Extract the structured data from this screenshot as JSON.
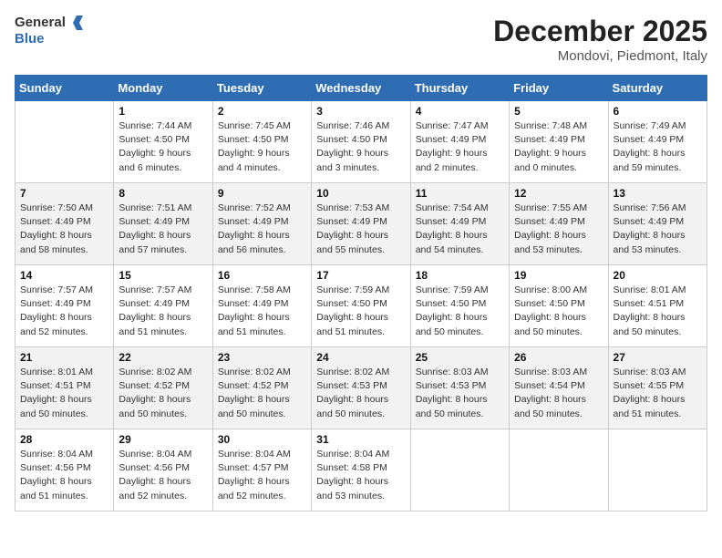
{
  "header": {
    "logo_line1": "General",
    "logo_line2": "Blue",
    "month": "December 2025",
    "location": "Mondovi, Piedmont, Italy"
  },
  "weekdays": [
    "Sunday",
    "Monday",
    "Tuesday",
    "Wednesday",
    "Thursday",
    "Friday",
    "Saturday"
  ],
  "weeks": [
    [
      {
        "day": "",
        "sunrise": "",
        "sunset": "",
        "daylight": ""
      },
      {
        "day": "1",
        "sunrise": "Sunrise: 7:44 AM",
        "sunset": "Sunset: 4:50 PM",
        "daylight": "Daylight: 9 hours and 6 minutes."
      },
      {
        "day": "2",
        "sunrise": "Sunrise: 7:45 AM",
        "sunset": "Sunset: 4:50 PM",
        "daylight": "Daylight: 9 hours and 4 minutes."
      },
      {
        "day": "3",
        "sunrise": "Sunrise: 7:46 AM",
        "sunset": "Sunset: 4:50 PM",
        "daylight": "Daylight: 9 hours and 3 minutes."
      },
      {
        "day": "4",
        "sunrise": "Sunrise: 7:47 AM",
        "sunset": "Sunset: 4:49 PM",
        "daylight": "Daylight: 9 hours and 2 minutes."
      },
      {
        "day": "5",
        "sunrise": "Sunrise: 7:48 AM",
        "sunset": "Sunset: 4:49 PM",
        "daylight": "Daylight: 9 hours and 0 minutes."
      },
      {
        "day": "6",
        "sunrise": "Sunrise: 7:49 AM",
        "sunset": "Sunset: 4:49 PM",
        "daylight": "Daylight: 8 hours and 59 minutes."
      }
    ],
    [
      {
        "day": "7",
        "sunrise": "Sunrise: 7:50 AM",
        "sunset": "Sunset: 4:49 PM",
        "daylight": "Daylight: 8 hours and 58 minutes."
      },
      {
        "day": "8",
        "sunrise": "Sunrise: 7:51 AM",
        "sunset": "Sunset: 4:49 PM",
        "daylight": "Daylight: 8 hours and 57 minutes."
      },
      {
        "day": "9",
        "sunrise": "Sunrise: 7:52 AM",
        "sunset": "Sunset: 4:49 PM",
        "daylight": "Daylight: 8 hours and 56 minutes."
      },
      {
        "day": "10",
        "sunrise": "Sunrise: 7:53 AM",
        "sunset": "Sunset: 4:49 PM",
        "daylight": "Daylight: 8 hours and 55 minutes."
      },
      {
        "day": "11",
        "sunrise": "Sunrise: 7:54 AM",
        "sunset": "Sunset: 4:49 PM",
        "daylight": "Daylight: 8 hours and 54 minutes."
      },
      {
        "day": "12",
        "sunrise": "Sunrise: 7:55 AM",
        "sunset": "Sunset: 4:49 PM",
        "daylight": "Daylight: 8 hours and 53 minutes."
      },
      {
        "day": "13",
        "sunrise": "Sunrise: 7:56 AM",
        "sunset": "Sunset: 4:49 PM",
        "daylight": "Daylight: 8 hours and 53 minutes."
      }
    ],
    [
      {
        "day": "14",
        "sunrise": "Sunrise: 7:57 AM",
        "sunset": "Sunset: 4:49 PM",
        "daylight": "Daylight: 8 hours and 52 minutes."
      },
      {
        "day": "15",
        "sunrise": "Sunrise: 7:57 AM",
        "sunset": "Sunset: 4:49 PM",
        "daylight": "Daylight: 8 hours and 51 minutes."
      },
      {
        "day": "16",
        "sunrise": "Sunrise: 7:58 AM",
        "sunset": "Sunset: 4:49 PM",
        "daylight": "Daylight: 8 hours and 51 minutes."
      },
      {
        "day": "17",
        "sunrise": "Sunrise: 7:59 AM",
        "sunset": "Sunset: 4:50 PM",
        "daylight": "Daylight: 8 hours and 51 minutes."
      },
      {
        "day": "18",
        "sunrise": "Sunrise: 7:59 AM",
        "sunset": "Sunset: 4:50 PM",
        "daylight": "Daylight: 8 hours and 50 minutes."
      },
      {
        "day": "19",
        "sunrise": "Sunrise: 8:00 AM",
        "sunset": "Sunset: 4:50 PM",
        "daylight": "Daylight: 8 hours and 50 minutes."
      },
      {
        "day": "20",
        "sunrise": "Sunrise: 8:01 AM",
        "sunset": "Sunset: 4:51 PM",
        "daylight": "Daylight: 8 hours and 50 minutes."
      }
    ],
    [
      {
        "day": "21",
        "sunrise": "Sunrise: 8:01 AM",
        "sunset": "Sunset: 4:51 PM",
        "daylight": "Daylight: 8 hours and 50 minutes."
      },
      {
        "day": "22",
        "sunrise": "Sunrise: 8:02 AM",
        "sunset": "Sunset: 4:52 PM",
        "daylight": "Daylight: 8 hours and 50 minutes."
      },
      {
        "day": "23",
        "sunrise": "Sunrise: 8:02 AM",
        "sunset": "Sunset: 4:52 PM",
        "daylight": "Daylight: 8 hours and 50 minutes."
      },
      {
        "day": "24",
        "sunrise": "Sunrise: 8:02 AM",
        "sunset": "Sunset: 4:53 PM",
        "daylight": "Daylight: 8 hours and 50 minutes."
      },
      {
        "day": "25",
        "sunrise": "Sunrise: 8:03 AM",
        "sunset": "Sunset: 4:53 PM",
        "daylight": "Daylight: 8 hours and 50 minutes."
      },
      {
        "day": "26",
        "sunrise": "Sunrise: 8:03 AM",
        "sunset": "Sunset: 4:54 PM",
        "daylight": "Daylight: 8 hours and 50 minutes."
      },
      {
        "day": "27",
        "sunrise": "Sunrise: 8:03 AM",
        "sunset": "Sunset: 4:55 PM",
        "daylight": "Daylight: 8 hours and 51 minutes."
      }
    ],
    [
      {
        "day": "28",
        "sunrise": "Sunrise: 8:04 AM",
        "sunset": "Sunset: 4:56 PM",
        "daylight": "Daylight: 8 hours and 51 minutes."
      },
      {
        "day": "29",
        "sunrise": "Sunrise: 8:04 AM",
        "sunset": "Sunset: 4:56 PM",
        "daylight": "Daylight: 8 hours and 52 minutes."
      },
      {
        "day": "30",
        "sunrise": "Sunrise: 8:04 AM",
        "sunset": "Sunset: 4:57 PM",
        "daylight": "Daylight: 8 hours and 52 minutes."
      },
      {
        "day": "31",
        "sunrise": "Sunrise: 8:04 AM",
        "sunset": "Sunset: 4:58 PM",
        "daylight": "Daylight: 8 hours and 53 minutes."
      },
      {
        "day": "",
        "sunrise": "",
        "sunset": "",
        "daylight": ""
      },
      {
        "day": "",
        "sunrise": "",
        "sunset": "",
        "daylight": ""
      },
      {
        "day": "",
        "sunrise": "",
        "sunset": "",
        "daylight": ""
      }
    ]
  ]
}
